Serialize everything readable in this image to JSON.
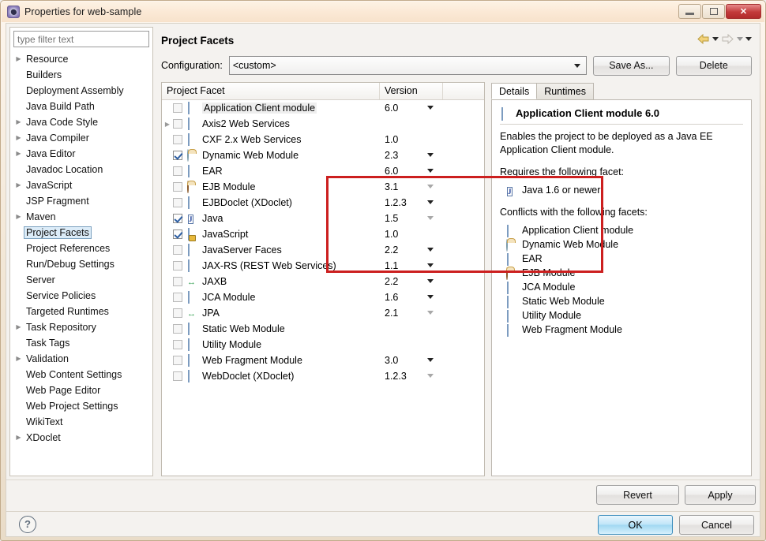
{
  "window": {
    "title": "Properties for web-sample",
    "icon": "eclipse-properties-icon",
    "minimize_label": "",
    "maximize_label": "",
    "close_label": "✕"
  },
  "sidebar": {
    "filter_placeholder": "type filter text",
    "filter_value": "",
    "items": [
      {
        "label": "Resource",
        "expandable": true,
        "selected": false
      },
      {
        "label": "Builders",
        "expandable": false,
        "selected": false
      },
      {
        "label": "Deployment Assembly",
        "expandable": false,
        "selected": false
      },
      {
        "label": "Java Build Path",
        "expandable": false,
        "selected": false
      },
      {
        "label": "Java Code Style",
        "expandable": true,
        "selected": false
      },
      {
        "label": "Java Compiler",
        "expandable": true,
        "selected": false
      },
      {
        "label": "Java Editor",
        "expandable": true,
        "selected": false
      },
      {
        "label": "Javadoc Location",
        "expandable": false,
        "selected": false
      },
      {
        "label": "JavaScript",
        "expandable": true,
        "selected": false
      },
      {
        "label": "JSP Fragment",
        "expandable": false,
        "selected": false
      },
      {
        "label": "Maven",
        "expandable": true,
        "selected": false
      },
      {
        "label": "Project Facets",
        "expandable": false,
        "selected": true
      },
      {
        "label": "Project References",
        "expandable": false,
        "selected": false
      },
      {
        "label": "Run/Debug Settings",
        "expandable": false,
        "selected": false
      },
      {
        "label": "Server",
        "expandable": false,
        "selected": false
      },
      {
        "label": "Service Policies",
        "expandable": false,
        "selected": false
      },
      {
        "label": "Targeted Runtimes",
        "expandable": false,
        "selected": false
      },
      {
        "label": "Task Repository",
        "expandable": true,
        "selected": false
      },
      {
        "label": "Task Tags",
        "expandable": false,
        "selected": false
      },
      {
        "label": "Validation",
        "expandable": true,
        "selected": false
      },
      {
        "label": "Web Content Settings",
        "expandable": false,
        "selected": false
      },
      {
        "label": "Web Page Editor",
        "expandable": false,
        "selected": false
      },
      {
        "label": "Web Project Settings",
        "expandable": false,
        "selected": false
      },
      {
        "label": "WikiText",
        "expandable": false,
        "selected": false
      },
      {
        "label": "XDoclet",
        "expandable": true,
        "selected": false
      }
    ]
  },
  "page": {
    "title": "Project Facets",
    "nav_back_icon": "back-arrow-icon",
    "nav_forward_icon": "forward-arrow-icon",
    "nav_menu_icon": "chevron-down-icon"
  },
  "configuration": {
    "label": "Configuration:",
    "value": "<custom>",
    "save_as_label": "Save As...",
    "delete_label": "Delete"
  },
  "facet_table": {
    "columns": [
      "Project Facet",
      "Version"
    ],
    "rows": [
      {
        "name": "Application Client module",
        "version": "6.0",
        "checked": false,
        "icon": "doc",
        "expandable": false,
        "caret": true,
        "caret_dim": false,
        "highlighted": true,
        "in_red_box": false
      },
      {
        "name": "Axis2 Web Services",
        "version": "",
        "checked": false,
        "icon": "doc",
        "expandable": true,
        "caret": false,
        "caret_dim": false,
        "highlighted": false,
        "in_red_box": false
      },
      {
        "name": "CXF 2.x Web Services",
        "version": "1.0",
        "checked": false,
        "icon": "doc",
        "expandable": false,
        "caret": false,
        "caret_dim": false,
        "highlighted": false,
        "in_red_box": false
      },
      {
        "name": "Dynamic Web Module",
        "version": "2.3",
        "checked": true,
        "icon": "globe",
        "expandable": false,
        "caret": true,
        "caret_dim": false,
        "highlighted": false,
        "in_red_box": true
      },
      {
        "name": "EAR",
        "version": "6.0",
        "checked": false,
        "icon": "doc",
        "expandable": false,
        "caret": true,
        "caret_dim": false,
        "highlighted": false,
        "in_red_box": true
      },
      {
        "name": "EJB Module",
        "version": "3.1",
        "checked": false,
        "icon": "bean",
        "expandable": false,
        "caret": true,
        "caret_dim": true,
        "highlighted": false,
        "in_red_box": true
      },
      {
        "name": "EJBDoclet (XDoclet)",
        "version": "1.2.3",
        "checked": false,
        "icon": "doc",
        "expandable": false,
        "caret": true,
        "caret_dim": false,
        "highlighted": false,
        "in_red_box": true
      },
      {
        "name": "Java",
        "version": "1.5",
        "checked": true,
        "icon": "java",
        "expandable": false,
        "caret": true,
        "caret_dim": true,
        "highlighted": false,
        "in_red_box": true
      },
      {
        "name": "JavaScript",
        "version": "1.0",
        "checked": true,
        "icon": "js",
        "expandable": false,
        "caret": false,
        "caret_dim": false,
        "highlighted": false,
        "in_red_box": true
      },
      {
        "name": "JavaServer Faces",
        "version": "2.2",
        "checked": false,
        "icon": "doc",
        "expandable": false,
        "caret": true,
        "caret_dim": false,
        "highlighted": false,
        "in_red_box": false
      },
      {
        "name": "JAX-RS (REST Web Services)",
        "version": "1.1",
        "checked": false,
        "icon": "doc",
        "expandable": false,
        "caret": true,
        "caret_dim": false,
        "highlighted": false,
        "in_red_box": false
      },
      {
        "name": "JAXB",
        "version": "2.2",
        "checked": false,
        "icon": "arrows",
        "expandable": false,
        "caret": true,
        "caret_dim": false,
        "highlighted": false,
        "in_red_box": false
      },
      {
        "name": "JCA Module",
        "version": "1.6",
        "checked": false,
        "icon": "doc",
        "expandable": false,
        "caret": true,
        "caret_dim": false,
        "highlighted": false,
        "in_red_box": false
      },
      {
        "name": "JPA",
        "version": "2.1",
        "checked": false,
        "icon": "arrows",
        "expandable": false,
        "caret": true,
        "caret_dim": true,
        "highlighted": false,
        "in_red_box": false
      },
      {
        "name": "Static Web Module",
        "version": "",
        "checked": false,
        "icon": "doc",
        "expandable": false,
        "caret": false,
        "caret_dim": false,
        "highlighted": false,
        "in_red_box": false
      },
      {
        "name": "Utility Module",
        "version": "",
        "checked": false,
        "icon": "doc",
        "expandable": false,
        "caret": false,
        "caret_dim": false,
        "highlighted": false,
        "in_red_box": false
      },
      {
        "name": "Web Fragment Module",
        "version": "3.0",
        "checked": false,
        "icon": "doc",
        "expandable": false,
        "caret": true,
        "caret_dim": false,
        "highlighted": false,
        "in_red_box": false
      },
      {
        "name": "WebDoclet (XDoclet)",
        "version": "1.2.3",
        "checked": false,
        "icon": "doc",
        "expandable": false,
        "caret": true,
        "caret_dim": true,
        "highlighted": false,
        "in_red_box": false
      }
    ]
  },
  "details": {
    "tabs": [
      {
        "label": "Details",
        "active": true
      },
      {
        "label": "Runtimes",
        "active": false
      }
    ],
    "title": "Application Client module 6.0",
    "title_icon": "doc",
    "description": "Enables the project to be deployed as a Java EE Application Client module.",
    "requires_heading": "Requires the following facet:",
    "requires": [
      {
        "label": "Java 1.6 or newer",
        "icon": "java"
      }
    ],
    "conflicts_heading": "Conflicts with the following facets:",
    "conflicts": [
      {
        "label": "Application Client module",
        "icon": "doc"
      },
      {
        "label": "Dynamic Web Module",
        "icon": "globe"
      },
      {
        "label": "EAR",
        "icon": "doc"
      },
      {
        "label": "EJB Module",
        "icon": "bean"
      },
      {
        "label": "JCA Module",
        "icon": "doc"
      },
      {
        "label": "Static Web Module",
        "icon": "doc"
      },
      {
        "label": "Utility Module",
        "icon": "doc"
      },
      {
        "label": "Web Fragment Module",
        "icon": "doc"
      }
    ]
  },
  "actions": {
    "revert_label": "Revert",
    "apply_label": "Apply",
    "ok_label": "OK",
    "cancel_label": "Cancel",
    "help_label": "?"
  },
  "colors": {
    "annotation_red": "#cc1f1f",
    "selection_blue": "#dcecf8",
    "ok_button_blue": "#a0d8f2",
    "titlebar_cream": "#fbe9d6"
  }
}
